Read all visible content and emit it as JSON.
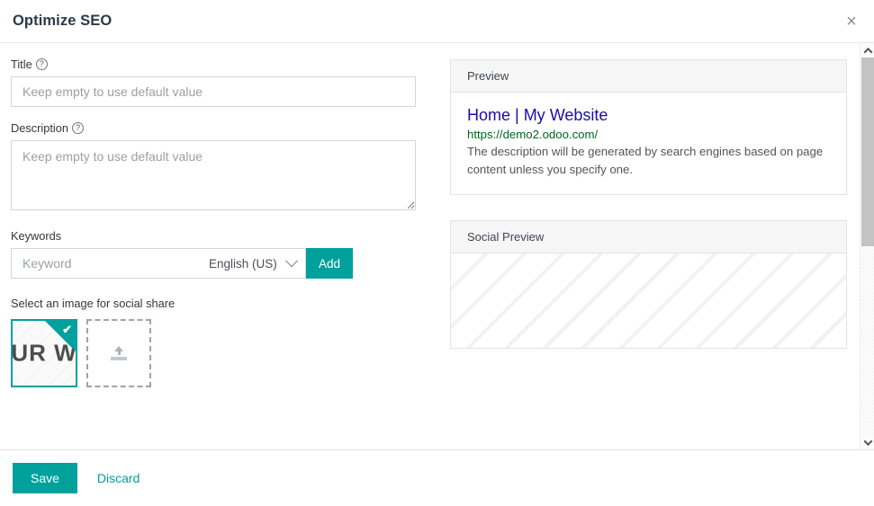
{
  "dialog": {
    "title": "Optimize SEO",
    "close_label": "×"
  },
  "form": {
    "title_field": {
      "label": "Title",
      "help_icon": "question-circle-icon",
      "help_glyph": "?",
      "value": "",
      "placeholder": "Keep empty to use default value"
    },
    "description_field": {
      "label": "Description",
      "help_icon": "question-circle-icon",
      "help_glyph": "?",
      "value": "",
      "placeholder": "Keep empty to use default value"
    },
    "keywords": {
      "label": "Keywords",
      "input_value": "",
      "input_placeholder": "Keyword",
      "language_selected": "English (US)",
      "language_options": [
        "English (US)"
      ],
      "add_label": "Add"
    },
    "social_image": {
      "label": "Select an image for social share",
      "thumbnail_text": "UR W",
      "selected": true,
      "check_glyph": "✔",
      "upload_icon": "upload-icon"
    }
  },
  "preview": {
    "header": "Preview",
    "serp_title": "Home | My Website",
    "serp_url": "https://demo2.odoo.com/",
    "serp_description": "The description will be generated by search engines based on page content unless you specify one."
  },
  "social_preview": {
    "header": "Social Preview"
  },
  "footer": {
    "save_label": "Save",
    "discard_label": "Discard"
  },
  "colors": {
    "accent": "#00a09d",
    "serp_title": "#1a0dab",
    "serp_url": "#006621",
    "title_text": "#2b3a4a"
  }
}
